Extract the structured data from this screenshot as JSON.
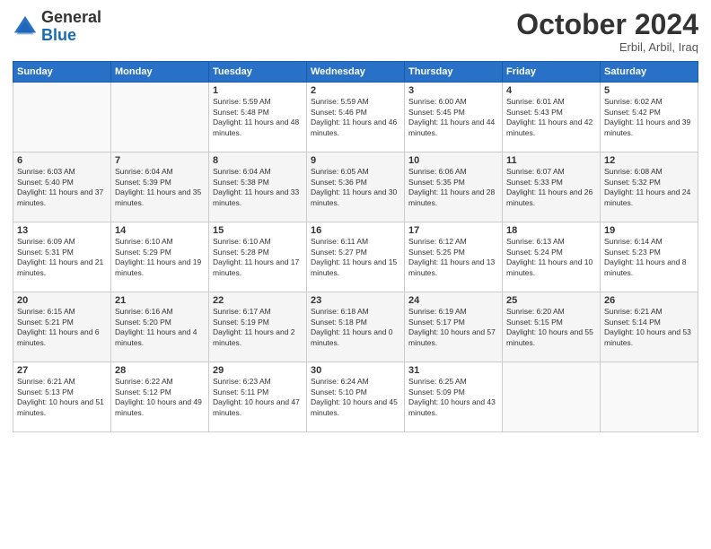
{
  "logo": {
    "line1": "General",
    "line2": "Blue"
  },
  "header": {
    "month": "October 2024",
    "location": "Erbil, Arbil, Iraq"
  },
  "weekdays": [
    "Sunday",
    "Monday",
    "Tuesday",
    "Wednesday",
    "Thursday",
    "Friday",
    "Saturday"
  ],
  "weeks": [
    [
      {
        "day": "",
        "info": ""
      },
      {
        "day": "",
        "info": ""
      },
      {
        "day": "1",
        "info": "Sunrise: 5:59 AM\nSunset: 5:48 PM\nDaylight: 11 hours and 48 minutes."
      },
      {
        "day": "2",
        "info": "Sunrise: 5:59 AM\nSunset: 5:46 PM\nDaylight: 11 hours and 46 minutes."
      },
      {
        "day": "3",
        "info": "Sunrise: 6:00 AM\nSunset: 5:45 PM\nDaylight: 11 hours and 44 minutes."
      },
      {
        "day": "4",
        "info": "Sunrise: 6:01 AM\nSunset: 5:43 PM\nDaylight: 11 hours and 42 minutes."
      },
      {
        "day": "5",
        "info": "Sunrise: 6:02 AM\nSunset: 5:42 PM\nDaylight: 11 hours and 39 minutes."
      }
    ],
    [
      {
        "day": "6",
        "info": "Sunrise: 6:03 AM\nSunset: 5:40 PM\nDaylight: 11 hours and 37 minutes."
      },
      {
        "day": "7",
        "info": "Sunrise: 6:04 AM\nSunset: 5:39 PM\nDaylight: 11 hours and 35 minutes."
      },
      {
        "day": "8",
        "info": "Sunrise: 6:04 AM\nSunset: 5:38 PM\nDaylight: 11 hours and 33 minutes."
      },
      {
        "day": "9",
        "info": "Sunrise: 6:05 AM\nSunset: 5:36 PM\nDaylight: 11 hours and 30 minutes."
      },
      {
        "day": "10",
        "info": "Sunrise: 6:06 AM\nSunset: 5:35 PM\nDaylight: 11 hours and 28 minutes."
      },
      {
        "day": "11",
        "info": "Sunrise: 6:07 AM\nSunset: 5:33 PM\nDaylight: 11 hours and 26 minutes."
      },
      {
        "day": "12",
        "info": "Sunrise: 6:08 AM\nSunset: 5:32 PM\nDaylight: 11 hours and 24 minutes."
      }
    ],
    [
      {
        "day": "13",
        "info": "Sunrise: 6:09 AM\nSunset: 5:31 PM\nDaylight: 11 hours and 21 minutes."
      },
      {
        "day": "14",
        "info": "Sunrise: 6:10 AM\nSunset: 5:29 PM\nDaylight: 11 hours and 19 minutes."
      },
      {
        "day": "15",
        "info": "Sunrise: 6:10 AM\nSunset: 5:28 PM\nDaylight: 11 hours and 17 minutes."
      },
      {
        "day": "16",
        "info": "Sunrise: 6:11 AM\nSunset: 5:27 PM\nDaylight: 11 hours and 15 minutes."
      },
      {
        "day": "17",
        "info": "Sunrise: 6:12 AM\nSunset: 5:25 PM\nDaylight: 11 hours and 13 minutes."
      },
      {
        "day": "18",
        "info": "Sunrise: 6:13 AM\nSunset: 5:24 PM\nDaylight: 11 hours and 10 minutes."
      },
      {
        "day": "19",
        "info": "Sunrise: 6:14 AM\nSunset: 5:23 PM\nDaylight: 11 hours and 8 minutes."
      }
    ],
    [
      {
        "day": "20",
        "info": "Sunrise: 6:15 AM\nSunset: 5:21 PM\nDaylight: 11 hours and 6 minutes."
      },
      {
        "day": "21",
        "info": "Sunrise: 6:16 AM\nSunset: 5:20 PM\nDaylight: 11 hours and 4 minutes."
      },
      {
        "day": "22",
        "info": "Sunrise: 6:17 AM\nSunset: 5:19 PM\nDaylight: 11 hours and 2 minutes."
      },
      {
        "day": "23",
        "info": "Sunrise: 6:18 AM\nSunset: 5:18 PM\nDaylight: 11 hours and 0 minutes."
      },
      {
        "day": "24",
        "info": "Sunrise: 6:19 AM\nSunset: 5:17 PM\nDaylight: 10 hours and 57 minutes."
      },
      {
        "day": "25",
        "info": "Sunrise: 6:20 AM\nSunset: 5:15 PM\nDaylight: 10 hours and 55 minutes."
      },
      {
        "day": "26",
        "info": "Sunrise: 6:21 AM\nSunset: 5:14 PM\nDaylight: 10 hours and 53 minutes."
      }
    ],
    [
      {
        "day": "27",
        "info": "Sunrise: 6:21 AM\nSunset: 5:13 PM\nDaylight: 10 hours and 51 minutes."
      },
      {
        "day": "28",
        "info": "Sunrise: 6:22 AM\nSunset: 5:12 PM\nDaylight: 10 hours and 49 minutes."
      },
      {
        "day": "29",
        "info": "Sunrise: 6:23 AM\nSunset: 5:11 PM\nDaylight: 10 hours and 47 minutes."
      },
      {
        "day": "30",
        "info": "Sunrise: 6:24 AM\nSunset: 5:10 PM\nDaylight: 10 hours and 45 minutes."
      },
      {
        "day": "31",
        "info": "Sunrise: 6:25 AM\nSunset: 5:09 PM\nDaylight: 10 hours and 43 minutes."
      },
      {
        "day": "",
        "info": ""
      },
      {
        "day": "",
        "info": ""
      }
    ]
  ]
}
